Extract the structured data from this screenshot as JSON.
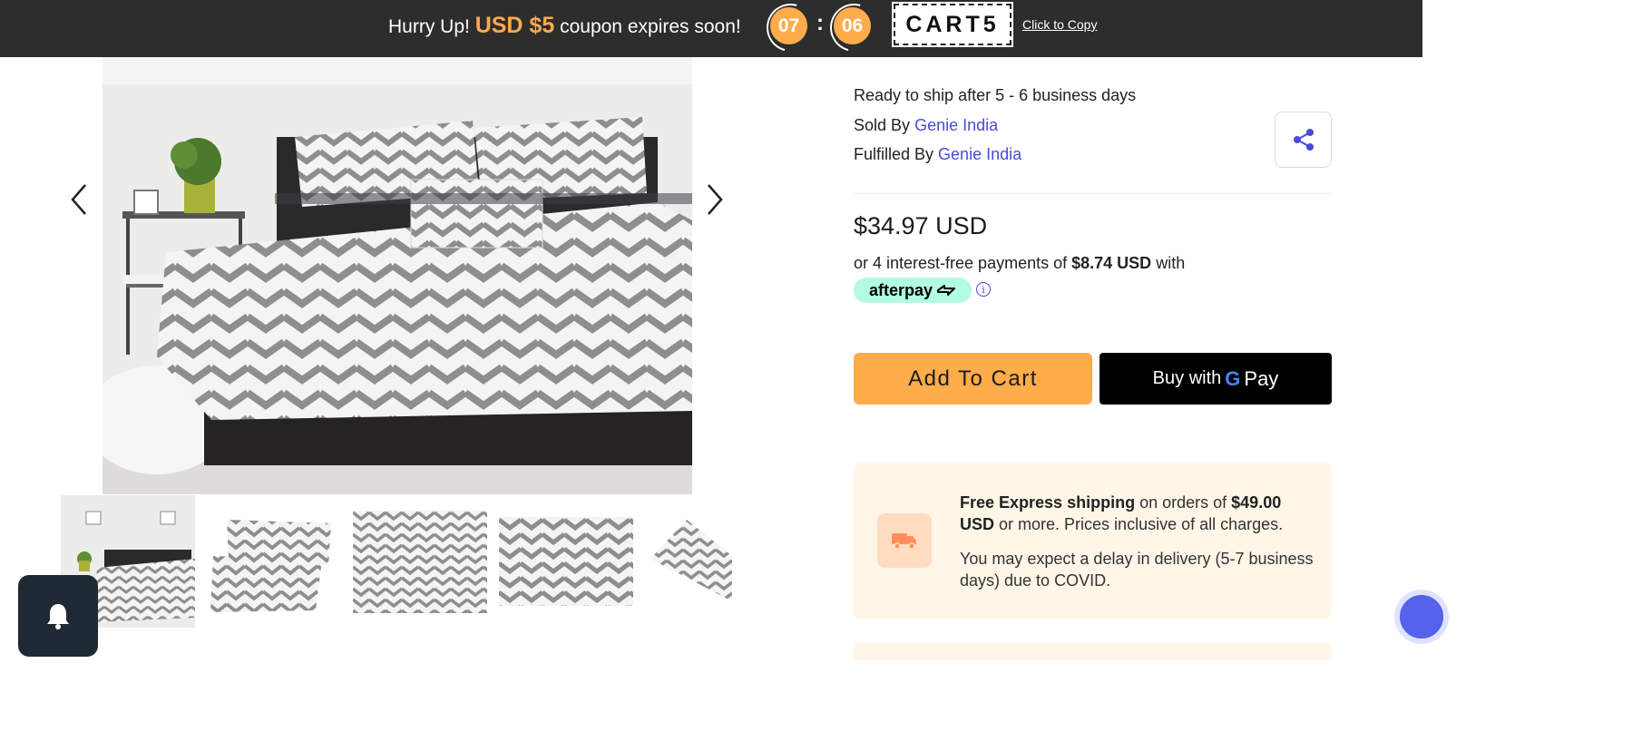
{
  "coupon_bar": {
    "prefix": "Hurry Up!",
    "amount": "USD $5",
    "suffix": "coupon expires soon!",
    "timer_minutes": "07",
    "timer_separator": ":",
    "timer_seconds": "06",
    "code": "CART5",
    "copy_label": "Click to Copy"
  },
  "gallery": {
    "thumbnail_count": 5
  },
  "product": {
    "ship_ready": "Ready to ship after 5 - 6 business days",
    "sold_by_label": "Sold By",
    "sold_by": "Genie India",
    "fulfilled_by_label": "Fulfilled By",
    "fulfilled_by": "Genie India",
    "price": "$34.97 USD",
    "installment_prefix": "or 4 interest-free payments of",
    "installment_amount": "$8.74 USD",
    "installment_suffix": "with",
    "afterpay_label": "afterpay",
    "info_glyph": "i"
  },
  "actions": {
    "add_to_cart": "Add To Cart",
    "buy_with": "Buy with",
    "gpay_g": "G",
    "gpay_pay": "Pay"
  },
  "shipping": {
    "bold_free": "Free Express shipping",
    "mid": "on orders of",
    "bold_amount": "$49.00 USD",
    "tail": "or more. Prices inclusive of all charges.",
    "delay": "You may expect a delay in delivery (5-7 business days) due to COVID."
  },
  "colors": {
    "accent_orange": "#ffac4b",
    "topbar_bg": "#2d2d2d",
    "link_blue": "#4a4ad8",
    "afterpay_mint": "#b2fce4"
  }
}
